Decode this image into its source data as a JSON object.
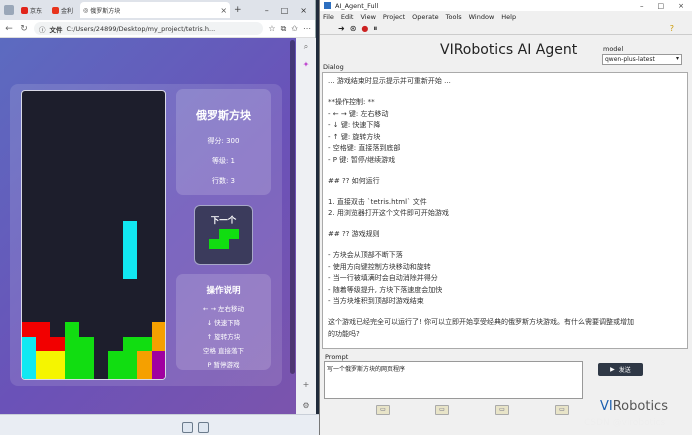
{
  "browser": {
    "tabs": [
      {
        "label": "京东",
        "color": "#e1251b"
      },
      {
        "label": "金利",
        "color": "#e8341c"
      }
    ],
    "active_tab": {
      "label": "俄罗斯方块"
    },
    "address": {
      "label": "文件",
      "url": "C:/Users/24899/Desktop/my_project/tetris.h..."
    }
  },
  "game": {
    "title": "俄罗斯方块",
    "score": "得分: 300",
    "level": "等级: 1",
    "lines": "行数: 3",
    "next_title": "下一个",
    "help_title": "操作说明",
    "help_lines": [
      "← → 左右移动",
      "↓ 快速下降",
      "↑ 旋转方块",
      "空格 直接落下",
      "P 暂停游戏"
    ],
    "colors": {
      "red": "#f20000",
      "green": "#11dd11",
      "cyan": "#11e8f2",
      "yellow": "#f5f500",
      "orange": "#f5a000",
      "purple": "#a000a0",
      "board": "#1d1e2c"
    }
  },
  "app": {
    "window_title": "AI_Agent_Full",
    "menu": [
      "File",
      "Edit",
      "View",
      "Project",
      "Operate",
      "Tools",
      "Window",
      "Help"
    ],
    "heading": "VIRobotics AI Agent",
    "model_label": "model",
    "model_value": "qwen-plus-latest",
    "dialog_label": "Dialog",
    "dialog_lines": [
      "... 游戏结束时显示提示并可重新开始 ...",
      "",
      "**操作控制: **",
      "- ← → 键: 左右移动",
      "- ↓ 键: 快速下降",
      "- ↑ 键: 旋转方块",
      "- 空格键: 直接落到底部",
      "- P 键: 暂停/继续游戏",
      "",
      "## ?? 如何运行",
      "",
      "1. 直接双击 `tetris.html` 文件",
      "2. 用浏览器打开这个文件即可开始游戏",
      "",
      "## ?? 游戏规则",
      "",
      "- 方块会从顶部不断下落",
      "- 使用方向键控制方块移动和旋转",
      "- 当一行被填满时会自动消除并得分",
      "- 随着等级提升, 方块下落速度会加快",
      "- 当方块堆积到顶部时游戏结束",
      "",
      "这个游戏已经完全可以运行了! 你可以立即开始享受经典的俄罗斯方块游戏。有什么需要调整或增加",
      "的功能吗?"
    ],
    "prompt_label": "Prompt",
    "prompt_value": "写一个俄罗斯方块的网页程序",
    "send_label": "发送",
    "logo_vi": "VI",
    "logo_rest": "Robotics"
  },
  "watermark": "CSDN @virobotics"
}
